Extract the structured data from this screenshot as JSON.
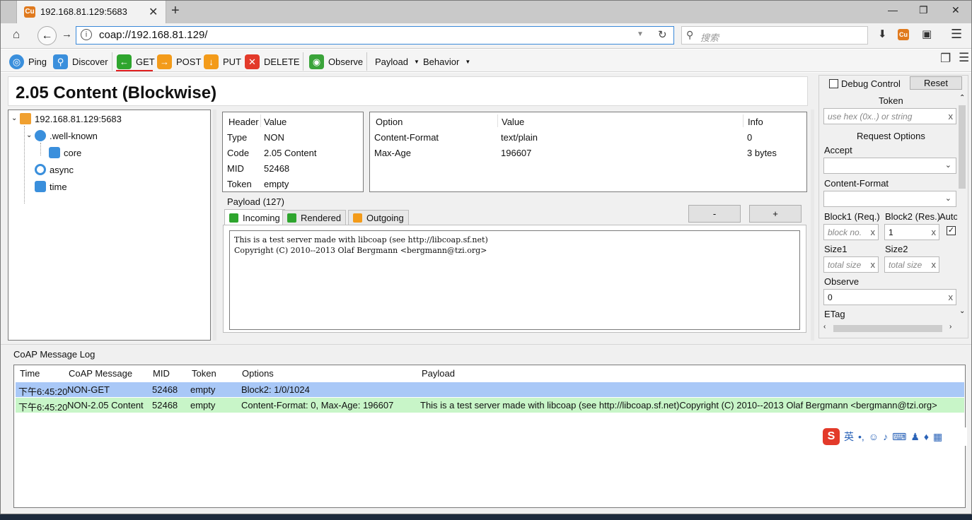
{
  "browser": {
    "tab_title": "192.168.81.129:5683",
    "tab_icon": "copper-icon",
    "close_tab": "✕",
    "new_tab": "+",
    "window_controls": [
      "—",
      "❐",
      "✕"
    ],
    "url": "coap://192.168.81.129/",
    "search_placeholder": "搜索"
  },
  "toolbar": {
    "ping": "Ping",
    "discover": "Discover",
    "get": "GET",
    "post": "POST",
    "put": "PUT",
    "delete": "DELETE",
    "observe": "Observe",
    "payload": "Payload",
    "behavior": "Behavior",
    "colors": {
      "get": "#2ea52e",
      "post": "#f39b1a",
      "put": "#f39b1a",
      "delete": "#e33a2a",
      "observe": "#3aa43a",
      "ping": "#3a8fdc"
    }
  },
  "status_title": "2.05 Content (Blockwise)",
  "tree": {
    "root": "192.168.81.129:5683",
    "items": [
      ".well-known",
      "core",
      "async",
      "time"
    ]
  },
  "header_table": {
    "col_header": "Header",
    "col_value": "Value",
    "rows": [
      {
        "k": "Type",
        "v": "NON"
      },
      {
        "k": "Code",
        "v": "2.05 Content"
      },
      {
        "k": "MID",
        "v": "52468"
      },
      {
        "k": "Token",
        "v": "empty"
      }
    ]
  },
  "options_table": {
    "col_option": "Option",
    "col_value": "Value",
    "col_info": "Info",
    "rows": [
      {
        "o": "Content-Format",
        "v": "text/plain",
        "i": "0"
      },
      {
        "o": "Max-Age",
        "v": "196607",
        "i": "3 bytes"
      }
    ]
  },
  "payload": {
    "label": "Payload (127)",
    "tabs": [
      "Incoming",
      "Rendered",
      "Outgoing"
    ],
    "minus": "-",
    "plus": "+",
    "text": "This is a test server made with libcoap (see http://libcoap.sf.net)\nCopyright (C) 2010--2013 Olaf Bergmann <bergmann@tzi.org>"
  },
  "right_panel": {
    "debug_control": "Debug Control",
    "reset": "Reset",
    "token": "Token",
    "token_placeholder": "use hex (0x..) or string",
    "request_options": "Request Options",
    "accept": "Accept",
    "content_format": "Content-Format",
    "block1": "Block1 (Req.)",
    "block2": "Block2 (Res.)",
    "auto": "Auto",
    "block1_placeholder": "block no.",
    "block2_value": "1",
    "size1": "Size1",
    "size2": "Size2",
    "size_placeholder": "total size",
    "observe": "Observe",
    "observe_value": "0",
    "etag": "ETag",
    "clear": "x"
  },
  "log": {
    "title": "CoAP Message Log",
    "columns": [
      "Time",
      "CoAP Message",
      "MID",
      "Token",
      "Options",
      "Payload"
    ],
    "rows": [
      {
        "time": "下午6:45:20",
        "msg": "NON-GET",
        "mid": "52468",
        "token": "empty",
        "options": "Block2: 1/0/1024",
        "payload": "",
        "color": "#a9c8f7"
      },
      {
        "time": "下午6:45:20",
        "msg": "NON-2.05 Content",
        "mid": "52468",
        "token": "empty",
        "options": "Content-Format: 0, Max-Age: 196607",
        "payload": "This is a test server made with libcoap (see http://libcoap.sf.net)Copyright (C) 2010--2013 Olaf Bergmann <bergmann@tzi.org>",
        "color": "#c8f5c8"
      }
    ]
  },
  "ime": {
    "logo": "S",
    "lang": "英"
  }
}
